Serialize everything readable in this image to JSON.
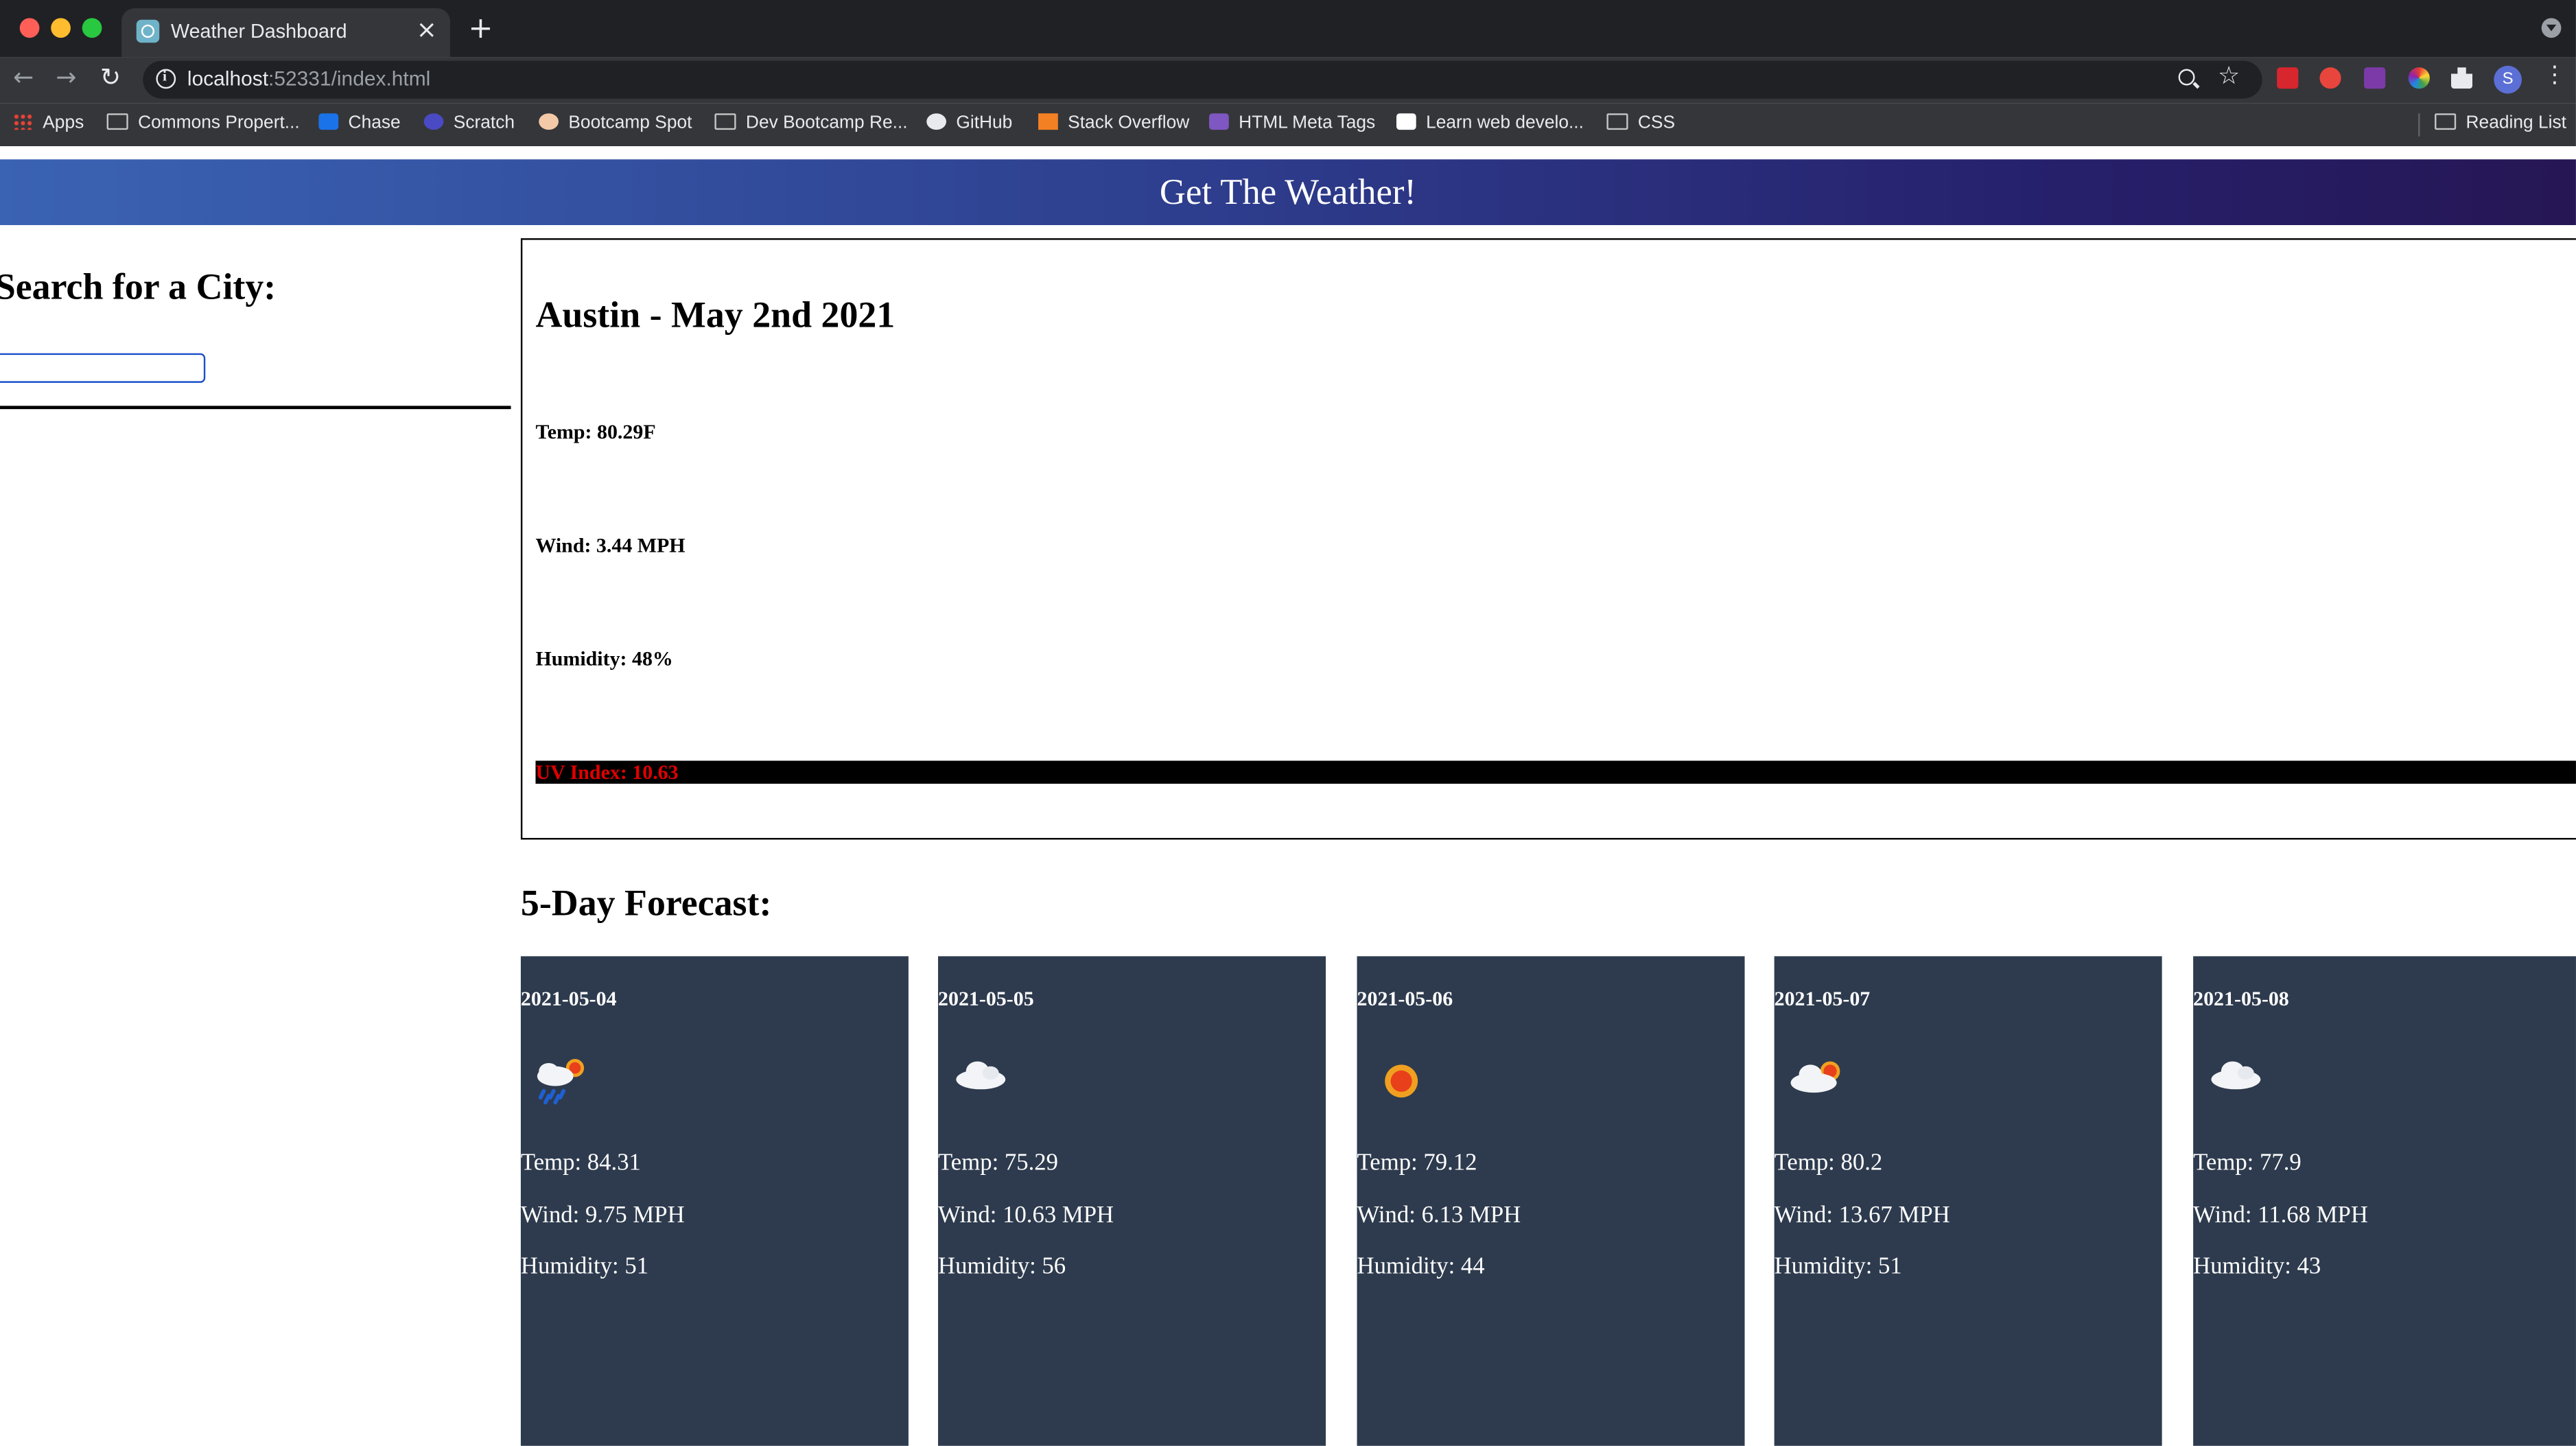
{
  "browser": {
    "tab_title": "Weather Dashboard",
    "tab_close": "×",
    "new_tab": "+",
    "url_host": "localhost",
    "url_rest": ":52331/index.html",
    "avatar_letter": "S",
    "bookmarks": [
      {
        "label": "Apps",
        "icon": "apps-grid-icon"
      },
      {
        "label": "Commons Propert...",
        "icon": "folder-icon"
      },
      {
        "label": "Chase",
        "icon": "chase-icon"
      },
      {
        "label": "Scratch",
        "icon": "scratch-icon"
      },
      {
        "label": "Bootcamp Spot",
        "icon": "bootcamp-icon"
      },
      {
        "label": "Dev Bootcamp Re...",
        "icon": "folder-icon"
      },
      {
        "label": "GitHub",
        "icon": "github-icon"
      },
      {
        "label": "Stack Overflow",
        "icon": "stackoverflow-icon"
      },
      {
        "label": "HTML Meta Tags",
        "icon": "meta-tags-icon"
      },
      {
        "label": "Learn web develo...",
        "icon": "mdn-icon"
      },
      {
        "label": "CSS",
        "icon": "folder-icon"
      }
    ],
    "reading_list": "Reading List"
  },
  "header": {
    "title": "Get The Weather!"
  },
  "search": {
    "title": "Search for a City:",
    "value": ""
  },
  "current": {
    "city": "Austin - May 2nd 2021",
    "temp": "Temp: 80.29F",
    "wind": "Wind: 3.44 MPH",
    "humidity": "Humidity: 48%",
    "uv": "UV Index: 10.63"
  },
  "forecast": {
    "title": "5-Day Forecast:",
    "days": [
      {
        "date": "2021-05-04",
        "icon": "rain-sun-icon",
        "temp": "Temp: 84.31",
        "wind": "Wind: 9.75 MPH",
        "humidity": "Humidity: 51"
      },
      {
        "date": "2021-05-05",
        "icon": "cloud-icon",
        "temp": "Temp: 75.29",
        "wind": "Wind: 10.63 MPH",
        "humidity": "Humidity: 56"
      },
      {
        "date": "2021-05-06",
        "icon": "sun-icon",
        "temp": "Temp: 79.12",
        "wind": "Wind: 6.13 MPH",
        "humidity": "Humidity: 44"
      },
      {
        "date": "2021-05-07",
        "icon": "cloud-sun-icon",
        "temp": "Temp: 80.2",
        "wind": "Wind: 13.67 MPH",
        "humidity": "Humidity: 51"
      },
      {
        "date": "2021-05-08",
        "icon": "cloud-icon",
        "temp": "Temp: 77.9",
        "wind": "Wind: 11.68 MPH",
        "humidity": "Humidity: 43"
      }
    ]
  },
  "colors": {
    "header_start": "#3b63b3",
    "header_end": "#261654",
    "card_bg": "#2e3b4e",
    "uv_text": "#e00000"
  }
}
